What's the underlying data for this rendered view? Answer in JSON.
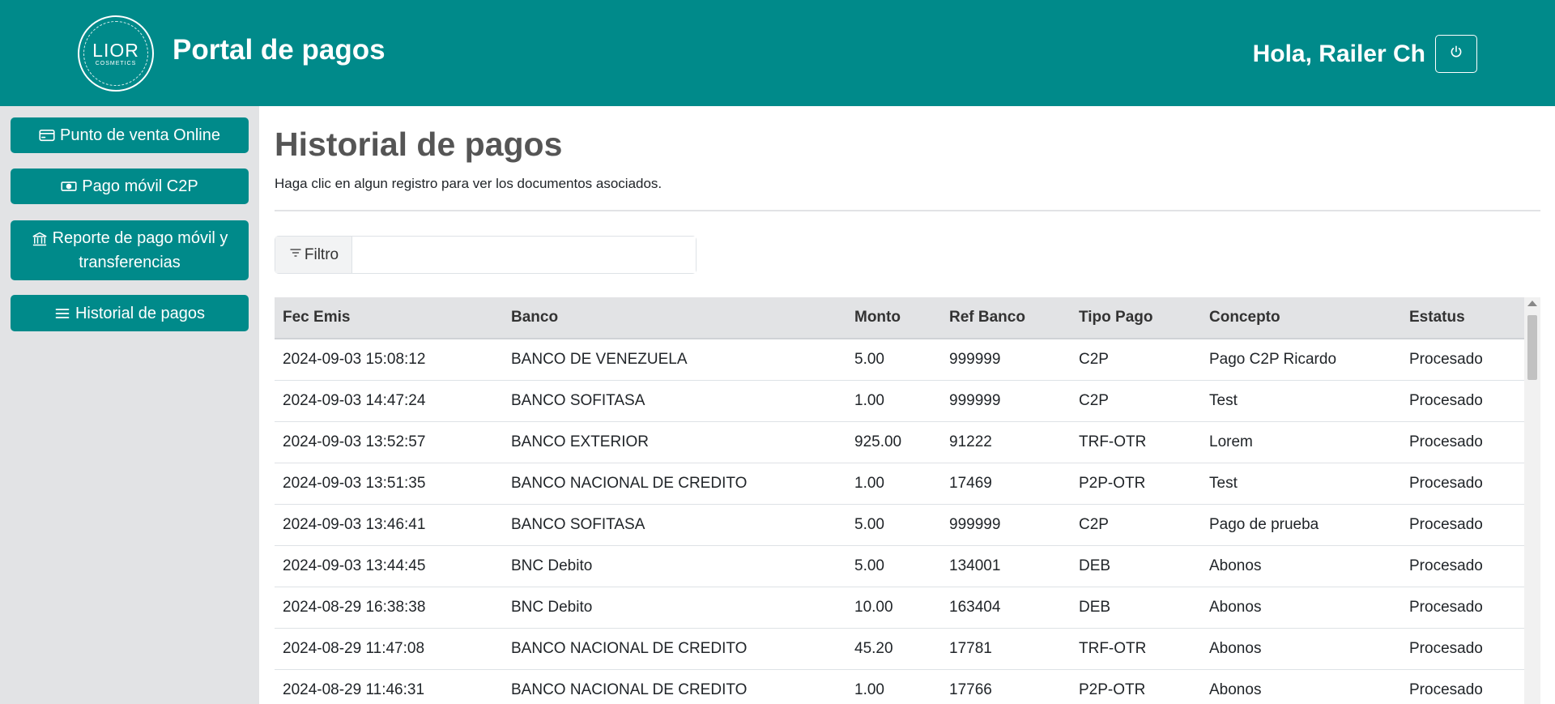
{
  "header": {
    "logo_text": "LIOR",
    "logo_subtext": "COSMETICS",
    "title": "Portal de pagos",
    "greeting": "Hola, Railer Ch"
  },
  "sidebar": {
    "items": [
      {
        "label": "Punto de venta Online",
        "icon": "credit-card-icon"
      },
      {
        "label": "Pago móvil C2P",
        "icon": "cash-icon"
      },
      {
        "label": "Reporte de pago móvil y transferencias",
        "icon": "bank-icon"
      },
      {
        "label": "Historial de pagos",
        "icon": "list-icon"
      }
    ]
  },
  "main": {
    "title": "Historial de pagos",
    "description": "Haga clic en algun registro para ver los documentos asociados.",
    "filter": {
      "label": "Filtro",
      "value": ""
    }
  },
  "table": {
    "headers": [
      "Fec Emis",
      "Banco",
      "Monto",
      "Ref Banco",
      "Tipo Pago",
      "Concepto",
      "Estatus"
    ],
    "rows": [
      [
        "2024-09-03 15:08:12",
        "BANCO DE VENEZUELA",
        "5.00",
        "999999",
        "C2P",
        "Pago C2P Ricardo",
        "Procesado"
      ],
      [
        "2024-09-03 14:47:24",
        "BANCO SOFITASA",
        "1.00",
        "999999",
        "C2P",
        "Test",
        "Procesado"
      ],
      [
        "2024-09-03 13:52:57",
        "BANCO EXTERIOR",
        "925.00",
        "91222",
        "TRF-OTR",
        "Lorem",
        "Procesado"
      ],
      [
        "2024-09-03 13:51:35",
        "BANCO NACIONAL DE CREDITO",
        "1.00",
        "17469",
        "P2P-OTR",
        "Test",
        "Procesado"
      ],
      [
        "2024-09-03 13:46:41",
        "BANCO SOFITASA",
        "5.00",
        "999999",
        "C2P",
        "Pago de prueba",
        "Procesado"
      ],
      [
        "2024-09-03 13:44:45",
        "BNC Debito",
        "5.00",
        "134001",
        "DEB",
        "Abonos",
        "Procesado"
      ],
      [
        "2024-08-29 16:38:38",
        "BNC Debito",
        "10.00",
        "163404",
        "DEB",
        "Abonos",
        "Procesado"
      ],
      [
        "2024-08-29 11:47:08",
        "BANCO NACIONAL DE CREDITO",
        "45.20",
        "17781",
        "TRF-OTR",
        "Abonos",
        "Procesado"
      ],
      [
        "2024-08-29 11:46:31",
        "BANCO NACIONAL DE CREDITO",
        "1.00",
        "17766",
        "P2P-OTR",
        "Abonos",
        "Procesado"
      ]
    ]
  },
  "colors": {
    "brand": "#008a8a",
    "sidebar_bg": "#e2e3e5",
    "table_header_bg": "#e2e3e5"
  }
}
